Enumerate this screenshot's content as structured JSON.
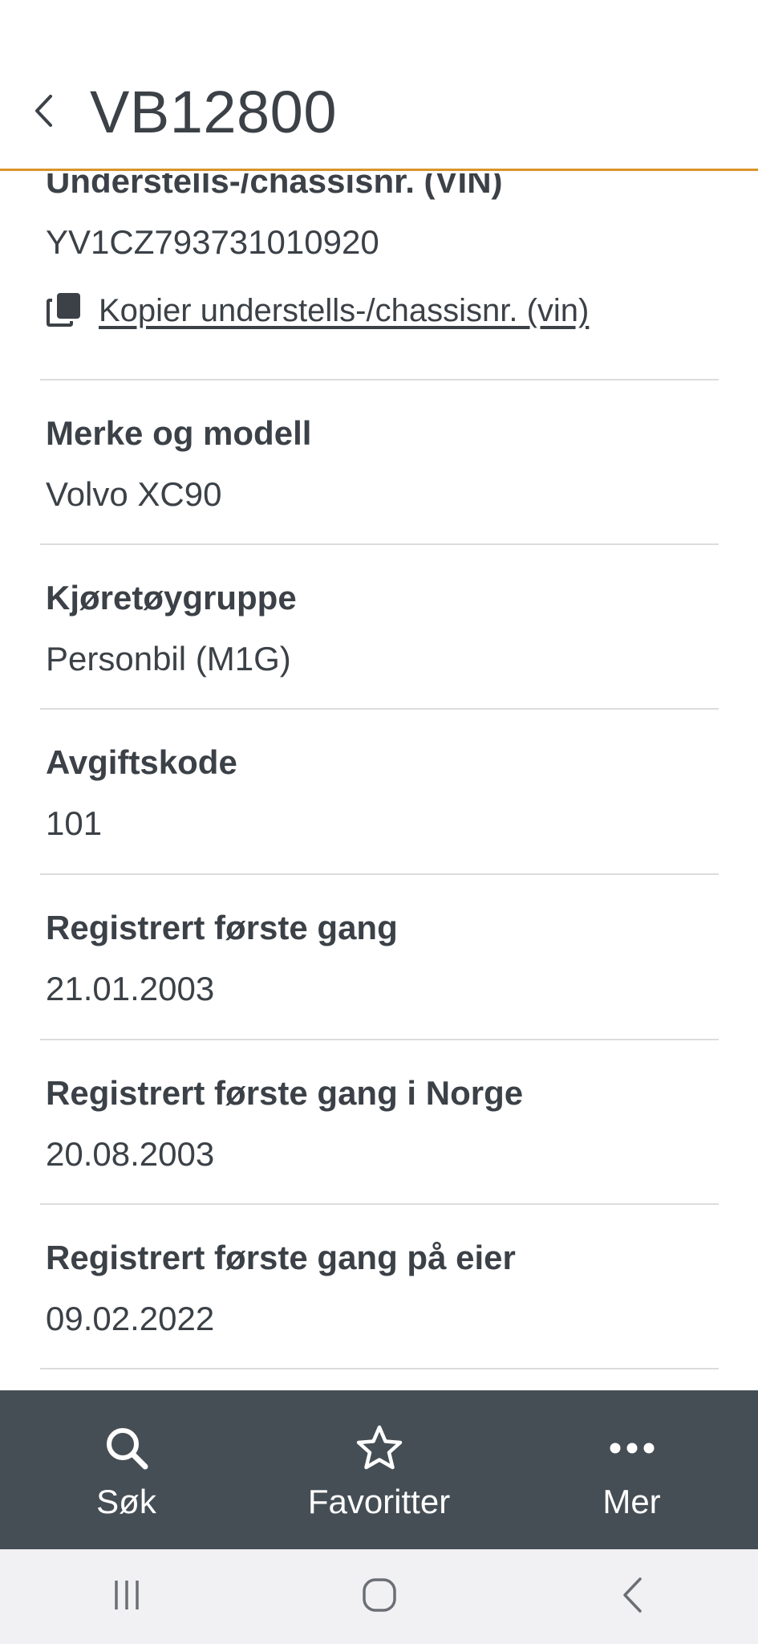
{
  "header": {
    "title": "VB12800",
    "back_icon": "chevron-left-icon"
  },
  "vin": {
    "label": "Understells-/chassisnr. (VIN)",
    "value": "YV1CZ793731010920",
    "copy_label": "Kopier understells-/chassisnr. (vin)",
    "copy_icon": "copy-icon"
  },
  "fields": [
    {
      "label": "Merke og modell",
      "value": "Volvo XC90"
    },
    {
      "label": "Kjøretøygruppe",
      "value": "Personbil (M1G)"
    },
    {
      "label": "Avgiftskode",
      "value": "101"
    },
    {
      "label": "Registrert første gang",
      "value": "21.01.2003"
    },
    {
      "label": "Registrert første gang i Norge",
      "value": "20.08.2003"
    },
    {
      "label": "Registrert første gang på eier",
      "value": "09.02.2022"
    }
  ],
  "bottom_nav": [
    {
      "label": "Søk",
      "icon": "search-icon"
    },
    {
      "label": "Favoritter",
      "icon": "star-icon"
    },
    {
      "label": "Mer",
      "icon": "more-dots-icon"
    }
  ],
  "system_nav": [
    "recent-apps-icon",
    "home-icon",
    "system-back-icon"
  ],
  "colors": {
    "accent": "#d9952a",
    "text": "#3b4147",
    "nav_bg": "#464e55",
    "divider": "#dcdcdc",
    "system_nav_bg": "#f1f1f3"
  }
}
